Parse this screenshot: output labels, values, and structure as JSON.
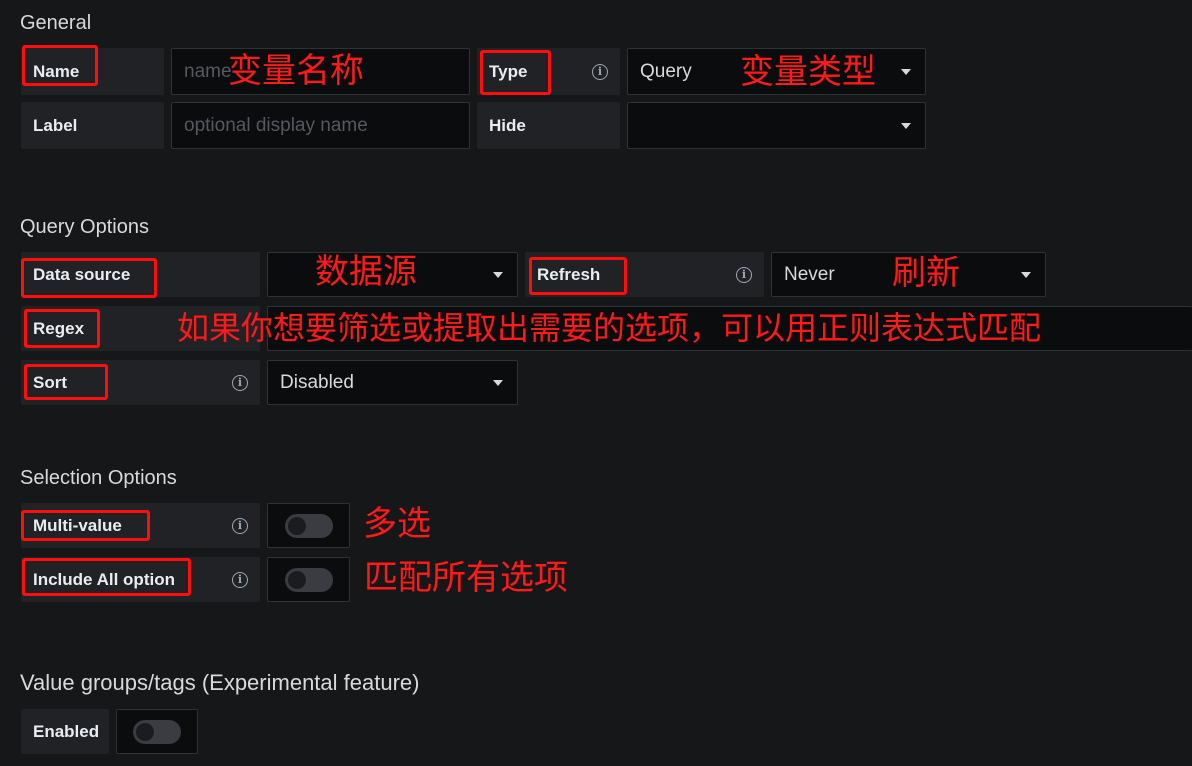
{
  "general": {
    "title": "General",
    "name_label": "Name",
    "name_placeholder": "name",
    "type_label": "Type",
    "type_value": "Query",
    "label_label": "Label",
    "label_placeholder": "optional display name",
    "hide_label": "Hide",
    "hide_value": ""
  },
  "query_options": {
    "title": "Query Options",
    "data_source_label": "Data source",
    "data_source_value": "",
    "refresh_label": "Refresh",
    "refresh_value": "Never",
    "regex_label": "Regex",
    "sort_label": "Sort",
    "sort_value": "Disabled"
  },
  "selection_options": {
    "title": "Selection Options",
    "multi_value_label": "Multi-value",
    "multi_value_enabled": false,
    "include_all_label": "Include All option",
    "include_all_enabled": false
  },
  "value_groups": {
    "title": "Value groups/tags (Experimental feature)",
    "enabled_label": "Enabled",
    "enabled": false
  },
  "annotations": {
    "name": "变量名称",
    "type": "变量类型",
    "data_source": "数据源",
    "refresh": "刷新",
    "regex": "如果你想要筛选或提取出需要的选项，可以用正则表达式匹配",
    "multi_value": "多选",
    "include_all": "匹配所有选项"
  },
  "colors": {
    "background": "#161719",
    "label_bg": "#202226",
    "input_bg": "#0b0c0e",
    "annotation_red": "#ff0e0e"
  },
  "icons": {
    "info": "info-circle-icon",
    "dropdown": "caret-down-icon"
  }
}
